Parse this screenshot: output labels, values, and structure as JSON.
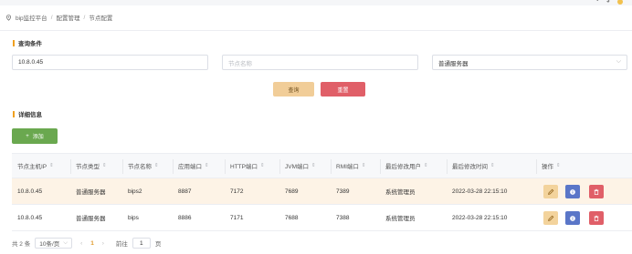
{
  "breadcrumb": [
    "bip监控平台",
    "配置管理",
    "节点配置"
  ],
  "query_section": {
    "title": "查询条件",
    "ip_value": "10.8.0.45",
    "name_placeholder": "节点名称",
    "type_value": "普通服务器",
    "query_label": "查询",
    "reset_label": "重置"
  },
  "detail_section": {
    "title": "详细信息",
    "add_label": "添加"
  },
  "table": {
    "headers": [
      "节点主机IP",
      "节点类型",
      "节点名称",
      "应用端口",
      "HTTP端口",
      "JVM端口",
      "RMI端口",
      "最后修改用户",
      "最后修改时间",
      "操作"
    ],
    "rows": [
      [
        "10.8.0.45",
        "普通服务器",
        "bips2",
        "8887",
        "7172",
        "7689",
        "7389",
        "系统管理员",
        "2022-03-28 22:15:10"
      ],
      [
        "10.8.0.45",
        "普通服务器",
        "bips",
        "8886",
        "7171",
        "7688",
        "7388",
        "系统管理员",
        "2022-03-28 22:15:10"
      ]
    ]
  },
  "pagination": {
    "total": "共 2 条",
    "page_size": "10条/页",
    "current": "1",
    "goto_label": "前往",
    "goto_value": "1",
    "page_unit": "页"
  },
  "colors": {
    "accent_orange": "#f0a020",
    "query_btn": "#f1cd98",
    "reset_btn": "#e05f68",
    "add_btn": "#6aa84f",
    "info_btn": "#5a76c8",
    "highlight_row": "#fdf3e6"
  }
}
